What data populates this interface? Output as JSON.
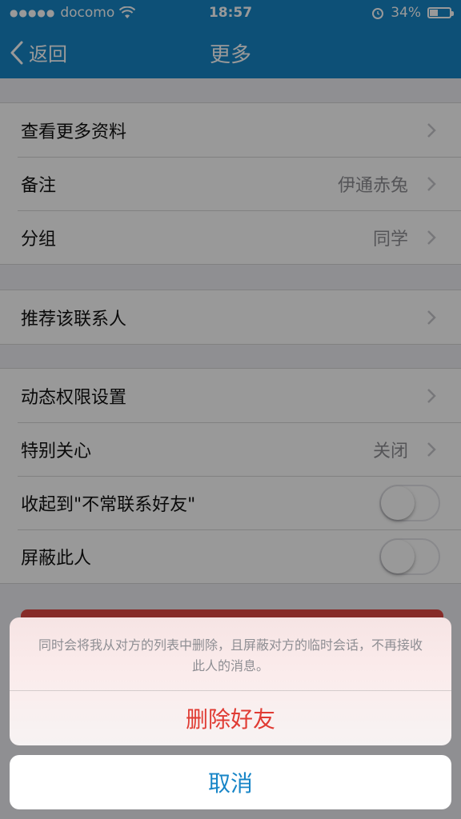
{
  "status_bar": {
    "carrier": "docomo",
    "time": "18:57",
    "battery": "34%"
  },
  "nav": {
    "back_label": "返回",
    "title": "更多"
  },
  "groups": [
    {
      "rows": [
        {
          "label": "查看更多资料",
          "value": ""
        },
        {
          "label": "备注",
          "value": "伊通赤兔"
        },
        {
          "label": "分组",
          "value": "同学"
        }
      ]
    },
    {
      "rows": [
        {
          "label": "推荐该联系人",
          "value": ""
        }
      ]
    },
    {
      "rows": [
        {
          "label": "动态权限设置",
          "value": ""
        },
        {
          "label": "特别关心",
          "value": "关闭"
        },
        {
          "label": "收起到\"不常联系好友\"",
          "toggle": false
        },
        {
          "label": "屏蔽此人",
          "toggle": false
        }
      ]
    }
  ],
  "action_sheet": {
    "message": "同时会将我从对方的列表中删除，且屏蔽对方的临时会话，不再接收此人的消息。",
    "delete_label": "删除好友",
    "cancel_label": "取消"
  },
  "colors": {
    "nav_blue": "#1785c7",
    "danger_red": "#e03b33"
  }
}
